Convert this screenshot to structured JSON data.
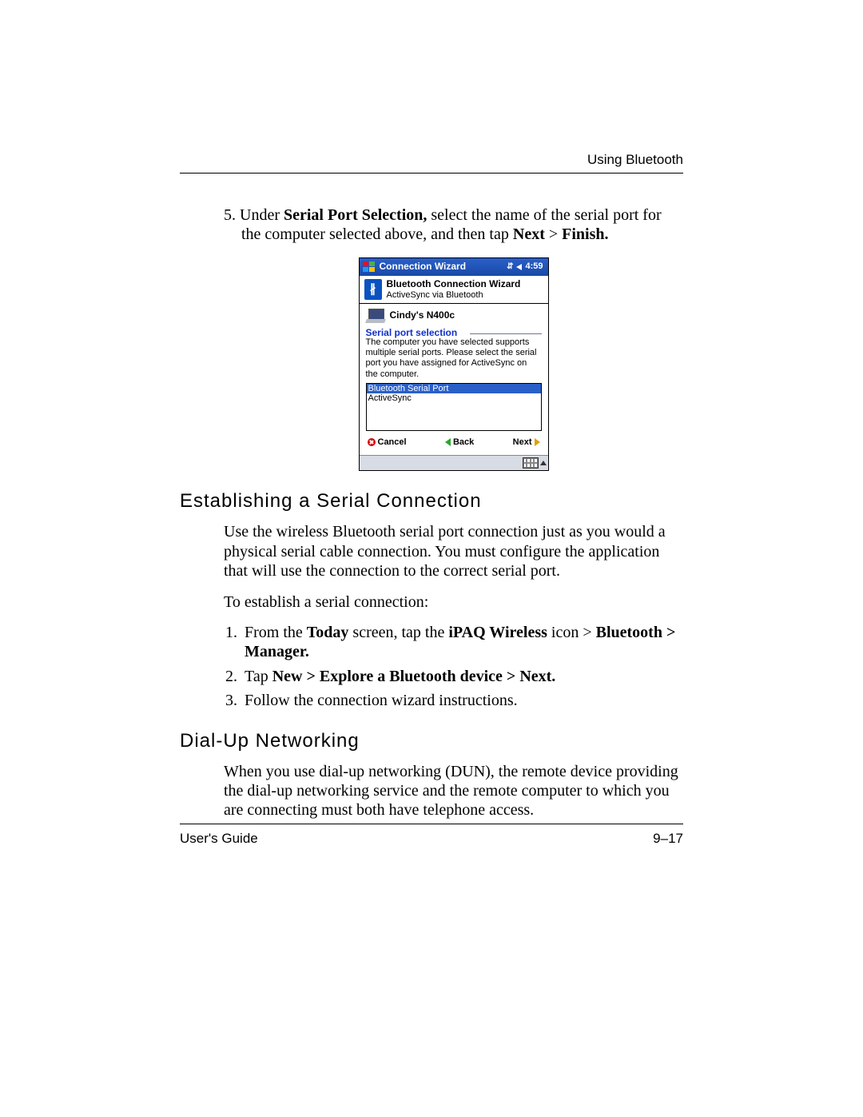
{
  "header": {
    "section": "Using Bluetooth"
  },
  "step5": {
    "num": "5.",
    "pre": "Under ",
    "b1": "Serial Port Selection,",
    "mid": " select the name of the serial port for the computer selected above, and then tap ",
    "b2": "Next",
    "gt": " > ",
    "b3": "Finish."
  },
  "device": {
    "titlebar": "Connection Wizard",
    "clock": "4:59",
    "wiz_title": "Bluetooth Connection Wizard",
    "wiz_sub": "ActiveSync via Bluetooth",
    "computer": "Cindy's N400c",
    "fieldset": "Serial port selection",
    "desc": "The computer you have selected supports multiple serial ports. Please select the serial port you have assigned for ActiveSync on the computer.",
    "options": [
      "Bluetooth Serial Port",
      "ActiveSync"
    ],
    "btn_cancel": "Cancel",
    "btn_back": "Back",
    "btn_next": "Next"
  },
  "h2a": "Establishing a Serial Connection",
  "p1": "Use the wireless Bluetooth serial port connection just as you would a physical serial cable connection. You must configure the application that will use the connection to the correct serial port.",
  "p2": "To establish a serial connection:",
  "ol": {
    "i1": {
      "pre": "From the ",
      "b1": "Today",
      "mid": " screen, tap the ",
      "b2": "iPAQ Wireless",
      "post1": " icon > ",
      "b3": "Bluetooth > Manager."
    },
    "i2": {
      "pre": "Tap ",
      "b1": "New > Explore a Bluetooth device > Next."
    },
    "i3": "Follow the connection wizard instructions."
  },
  "h2b": "Dial-Up Networking",
  "p3": "When you use dial-up networking (DUN), the remote device providing the dial-up networking service and the remote computer to which you are connecting must both have telephone access.",
  "footer": {
    "left": "User's Guide",
    "right": "9–17"
  }
}
